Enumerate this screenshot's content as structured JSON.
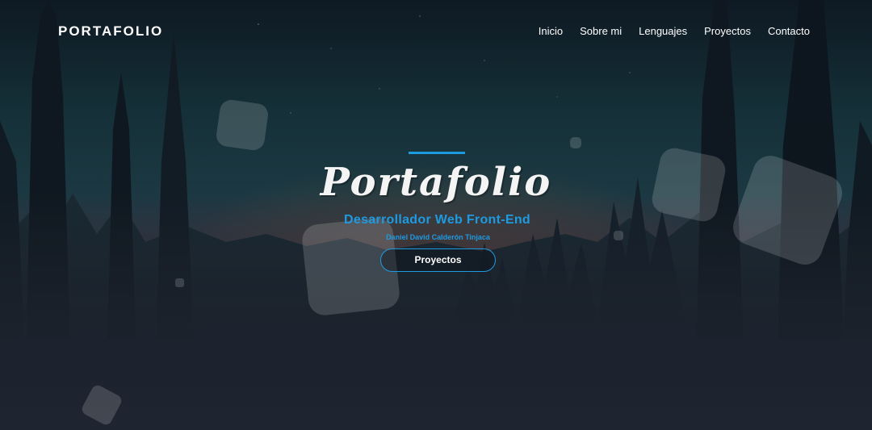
{
  "header": {
    "logo": "PORTAFOLIO"
  },
  "nav": {
    "items": [
      {
        "label": "Inicio"
      },
      {
        "label": "Sobre mi"
      },
      {
        "label": "Lenguajes"
      },
      {
        "label": "Proyectos"
      },
      {
        "label": "Contacto"
      }
    ]
  },
  "hero": {
    "title": "Portafolio",
    "subtitle": "Desarrollador Web Front-End",
    "name": "Daniel David Calderón Tinjaca",
    "cta_label": "Proyectos"
  },
  "colors": {
    "accent": "#1e9ae0",
    "background": "#1c222c",
    "text": "#ffffff"
  }
}
